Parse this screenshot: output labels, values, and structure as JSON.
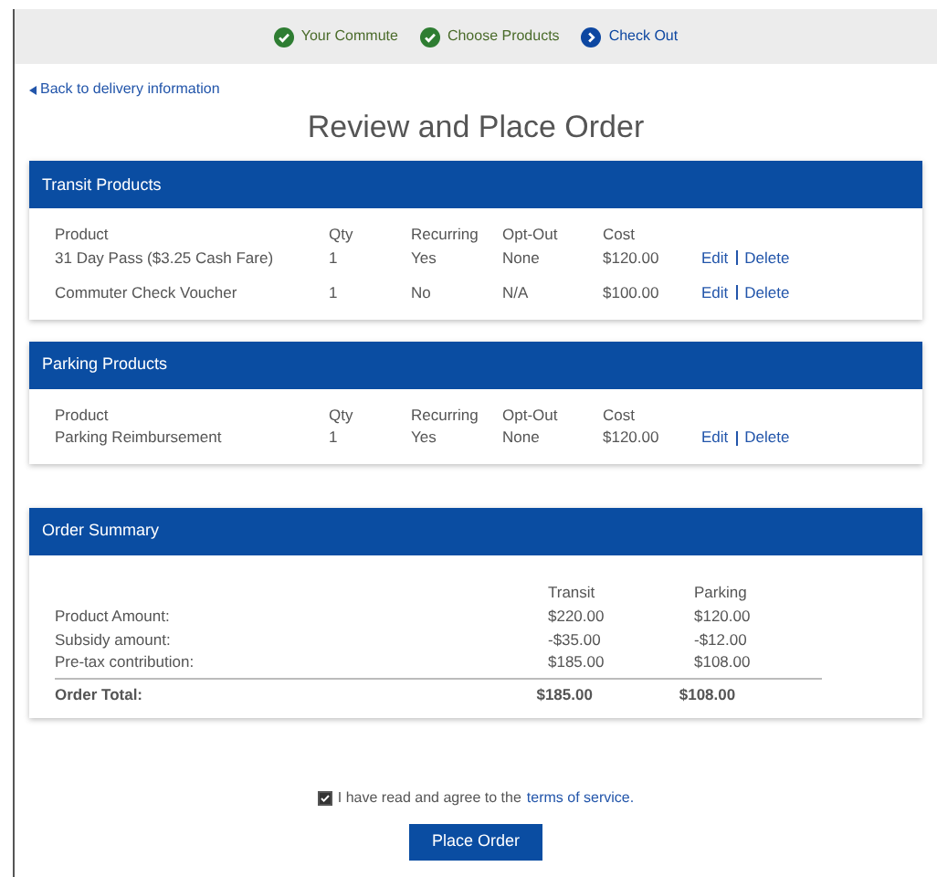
{
  "steps": [
    {
      "label": "Your Commute",
      "kind": "done"
    },
    {
      "label": "Choose Products",
      "kind": "done"
    },
    {
      "label": "Check Out",
      "kind": "current"
    }
  ],
  "back_link": "Back to delivery information",
  "title": "Review and Place Order",
  "product_sections": [
    {
      "title": "Transit Products",
      "columns": [
        "Product",
        "Qty",
        "Recurring",
        "Opt-Out",
        "Cost"
      ],
      "rows": [
        {
          "cells": [
            "31 Day Pass ($3.25 Cash Fare)",
            "1",
            "Yes",
            "None",
            "$120.00"
          ],
          "edit": "Edit",
          "delete": "Delete"
        },
        {
          "cells": [
            "Commuter Check Voucher",
            "1",
            "No",
            "N/A",
            "$100.00"
          ],
          "edit": "Edit",
          "delete": "Delete"
        }
      ]
    },
    {
      "title": "Parking Products",
      "columns": [
        "Product",
        "Qty",
        "Recurring",
        "Opt-Out",
        "Cost"
      ],
      "rows": [
        {
          "cells": [
            "Parking Reimbursement",
            "1",
            "Yes",
            "None",
            "$120.00"
          ],
          "edit": "Edit",
          "delete": "Delete"
        }
      ]
    }
  ],
  "summary": {
    "title": "Order Summary",
    "columns": [
      "Transit",
      "Parking"
    ],
    "rows": [
      {
        "label": "Product Amount:",
        "values": [
          "$220.00",
          "$120.00"
        ],
        "total": false
      },
      {
        "label": "Subsidy amount:",
        "values": [
          "-$35.00",
          "-$12.00"
        ],
        "total": false
      },
      {
        "label": "Pre-tax contribution:",
        "values": [
          "$185.00",
          "$108.00"
        ],
        "total": false
      },
      {
        "label": "Order Total:",
        "values": [
          "$185.00",
          "$108.00"
        ],
        "total": true
      }
    ]
  },
  "agreement": {
    "checked": true,
    "text": "I have read and agree to the",
    "link": "terms of service."
  },
  "submit": "Place Order"
}
